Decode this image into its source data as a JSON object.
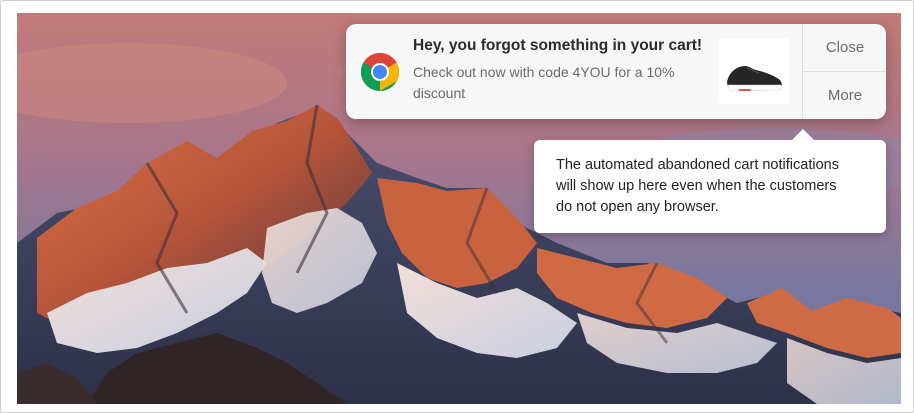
{
  "notification": {
    "app_icon": "chrome-icon",
    "title": "Hey, you forgot something in your cart!",
    "body_lines": [
      "Check out now with code 4YOU for a 10%",
      "discount"
    ],
    "product_image": "sneaker-image",
    "actions": {
      "close_label": "Close",
      "more_label": "More"
    }
  },
  "callout": {
    "lines": [
      "The automated abandoned cart notifications",
      "will show up here even when the customers",
      "do not open any browser."
    ]
  },
  "colors": {
    "sky_top": "#c97a7a",
    "sky_bottom": "#6f6f9a",
    "mountain_glow": "#e2774a",
    "snow": "#e6e8f0"
  }
}
